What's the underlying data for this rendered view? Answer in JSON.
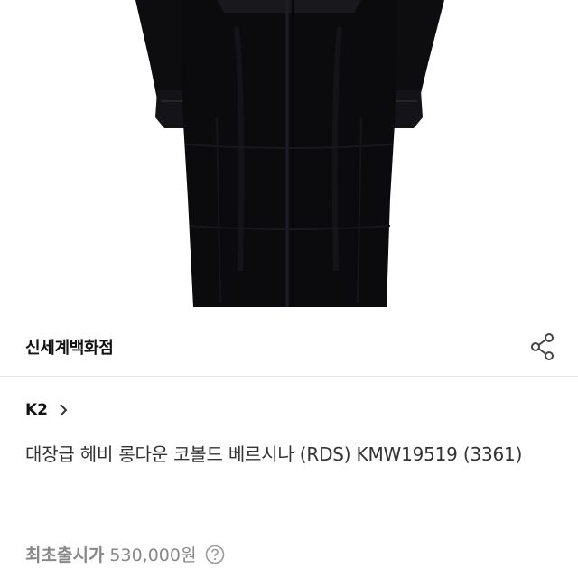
{
  "seller": {
    "name": "신세계백화점"
  },
  "share": {
    "icon": "share-icon"
  },
  "brand": {
    "name": "K2",
    "icon": "chevron-right-icon"
  },
  "product": {
    "title": "대장급 헤비 롱다운 코볼드 베르시나 (RDS) KMW19519 (3361)",
    "image_icon": "black-long-down-coat-image"
  },
  "price": {
    "label": "최초출시가",
    "value": "530,000원",
    "help_icon": "question-circle-icon"
  },
  "colors": {
    "text_primary": "#111111",
    "text_secondary": "#888888",
    "divider": "#e6e6e6",
    "coat": "#0c0c0e"
  }
}
